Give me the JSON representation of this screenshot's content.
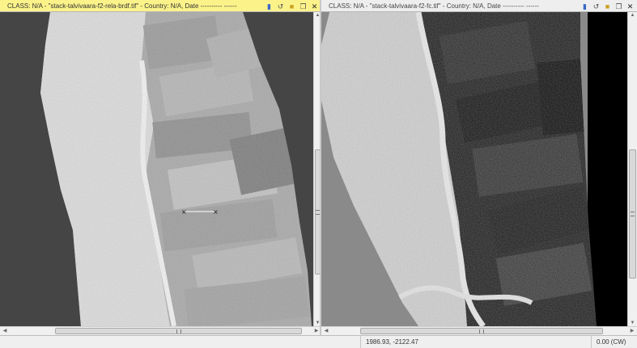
{
  "left_view": {
    "title": "CLASS: N/A - \"stack-talvivaara-f2-rela-brdf.tif\" - Country: N/A, Date ---------- ------"
  },
  "right_view": {
    "title": "CLASS: N/A - \"stack-talvivaara-f2-fc.tif\" - Country: N/A, Date ---------- ------"
  },
  "toolbar_icons": [
    "pin-icon",
    "sync-icon",
    "export-icon",
    "restore-icon",
    "close-icon"
  ],
  "status": {
    "coordinates": "1986.93, -2122.47",
    "rotation": "0.00 (CW)"
  },
  "colors": {
    "active_title": "#fbf28a",
    "inactive_title": "#eeeeee",
    "left_background": "#454545",
    "right_background": "#8a8a8a"
  }
}
